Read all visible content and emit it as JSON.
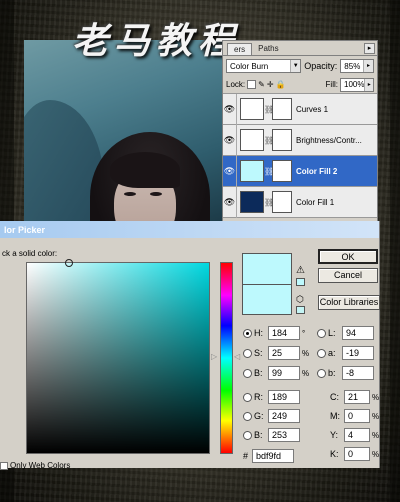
{
  "banner": {
    "title": "老马教程"
  },
  "layers_panel": {
    "tabs": [
      {
        "label": "ers"
      },
      {
        "label": "Paths"
      }
    ],
    "menu_btn": "▸",
    "blend_mode": "Color Burn",
    "opacity_label": "Opacity:",
    "opacity_value": "85%",
    "lock_label": "Lock:",
    "fill_label": "Fill:",
    "fill_value": "100%",
    "layers": [
      {
        "name": "Curves 1",
        "thumb_color": "#ffffff",
        "mask_color": "#ffffff"
      },
      {
        "name": "Brightness/Contr...",
        "thumb_color": "#ffffff",
        "mask_color": "#ffffff"
      },
      {
        "name": "Color Fill 2",
        "thumb_color": "#bdf9fd",
        "mask_color": "#ffffff"
      },
      {
        "name": "Color Fill 1",
        "thumb_color": "#0c2a5a",
        "mask_color": "#ffffff"
      }
    ]
  },
  "color_picker": {
    "title": "lor Picker",
    "prompt": "ck a solid color:",
    "ok_label": "OK",
    "cancel_label": "Cancel",
    "libraries_label": "Color Libraries",
    "current_color": "#bdf9fd",
    "hsb": {
      "h": "184",
      "h_unit": "°",
      "s": "25",
      "s_unit": "%",
      "b": "99",
      "b_unit": "%"
    },
    "rgb": {
      "r": "189",
      "g": "249",
      "b": "253"
    },
    "lab": {
      "l": "94",
      "a": "-19",
      "b": "-8"
    },
    "cmyk": {
      "c": "21",
      "m": "0",
      "y": "4",
      "k": "0",
      "unit": "%"
    },
    "labels": {
      "h": "H:",
      "s": "S:",
      "b": "B:",
      "r": "R:",
      "g": "G:",
      "bb": "B:",
      "l": "L:",
      "a": "a:",
      "lb": "b:",
      "c": "C:",
      "m": "M:",
      "y": "Y:",
      "k": "K:",
      "hash": "#"
    },
    "hex": "bdf9fd",
    "web_only_label": "Only Web Colors"
  }
}
